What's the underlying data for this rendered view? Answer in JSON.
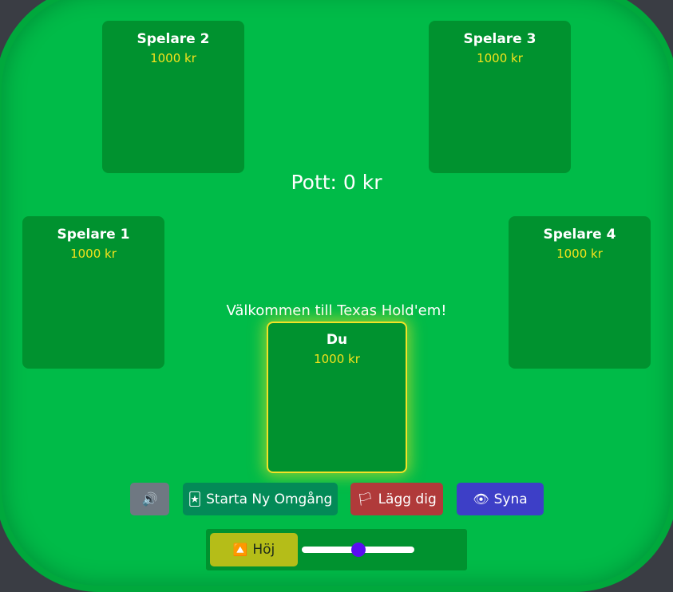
{
  "pot": {
    "label": "Pott: 0 kr"
  },
  "message": "Välkommen till Texas Hold'em!",
  "players": {
    "p1": {
      "name": "Spelare 1",
      "chips": "1000 kr"
    },
    "p2": {
      "name": "Spelare 2",
      "chips": "1000 kr"
    },
    "p3": {
      "name": "Spelare 3",
      "chips": "1000 kr"
    },
    "p4": {
      "name": "Spelare 4",
      "chips": "1000 kr"
    },
    "you": {
      "name": "Du",
      "chips": "1000 kr"
    }
  },
  "controls": {
    "sound": {
      "icon": "speaker-icon",
      "glyph": "🔊"
    },
    "new_round": {
      "label": "Starta Ny Omgång",
      "icon": "joker-card-icon",
      "glyph": "🃏"
    },
    "fold": {
      "label": "Lägg dig",
      "icon": "white-flag-icon",
      "glyph": "🏳"
    },
    "call": {
      "label": "Syna",
      "icon": "eye-icon",
      "glyph": "👁"
    },
    "raise": {
      "label": "Höj",
      "icon": "up-arrow-icon",
      "glyph": "🔼"
    },
    "raise_slider": {
      "value_fraction": 0.5
    }
  },
  "colors": {
    "felt": "#00bb48",
    "rail": "#00a83c",
    "seat": "#00922f",
    "chips_text": "#f3e21c",
    "active_highlight": "#f2e227",
    "slider_thumb": "#5a0df0"
  }
}
